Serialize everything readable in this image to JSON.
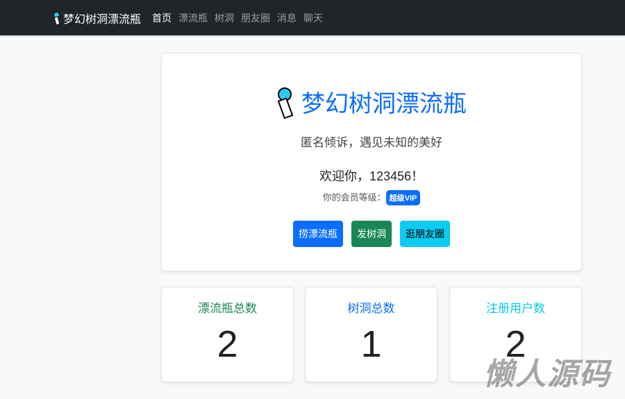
{
  "nav": {
    "brand": "梦幻树洞漂流瓶",
    "items": [
      "首页",
      "漂流瓶",
      "树洞",
      "朋友圈",
      "消息",
      "聊天"
    ]
  },
  "hero": {
    "title": "梦幻树洞漂流瓶",
    "subtitle": "匿名倾诉，遇见未知的美好",
    "welcome": "欢迎你，123456！",
    "level_label": "你的会员等级：",
    "level": "超级VIP",
    "buttons": [
      {
        "label": "捞漂流瓶",
        "color": "#0d6efd"
      },
      {
        "label": "发树洞",
        "color": "#198754"
      },
      {
        "label": "逛朋友圈",
        "color": "#0dcaf0"
      }
    ]
  },
  "stats": [
    {
      "label": "漂流瓶总数",
      "value": "2",
      "color": "#198754"
    },
    {
      "label": "树洞总数",
      "value": "1",
      "color": "#0d6efd"
    },
    {
      "label": "注册用户数",
      "value": "2",
      "color": "#0dcaf0"
    }
  ],
  "watermark": "懒人源码"
}
